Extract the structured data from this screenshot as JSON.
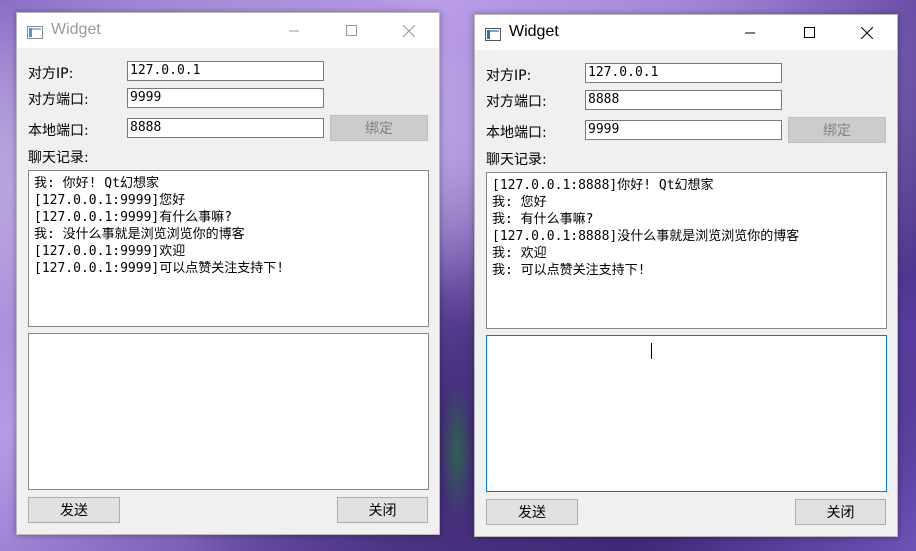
{
  "left_window": {
    "title": "Widget",
    "peer_ip_label": "对方IP:",
    "peer_ip_value": "127.0.0.1",
    "peer_port_label": "对方端口:",
    "peer_port_value": "9999",
    "local_port_label": "本地端口:",
    "local_port_value": "8888",
    "bind_label": "绑定",
    "chat_log_label": "聊天记录:",
    "chat_log": [
      "我: 你好! Qt幻想家",
      "[127.0.0.1:9999]您好",
      "[127.0.0.1:9999]有什么事嘛?",
      "我: 没什么事就是浏览浏览你的博客",
      "[127.0.0.1:9999]欢迎",
      "[127.0.0.1:9999]可以点赞关注支持下!"
    ],
    "message_input_value": "",
    "send_label": "发送",
    "close_label": "关闭"
  },
  "right_window": {
    "title": "Widget",
    "peer_ip_label": "对方IP:",
    "peer_ip_value": "127.0.0.1",
    "peer_port_label": "对方端口:",
    "peer_port_value": "8888",
    "local_port_label": "本地端口:",
    "local_port_value": "9999",
    "bind_label": "绑定",
    "chat_log_label": "聊天记录:",
    "chat_log": [
      "[127.0.0.1:8888]你好! Qt幻想家",
      "我: 您好",
      "我: 有什么事嘛?",
      "[127.0.0.1:8888]没什么事就是浏览浏览你的博客",
      "我: 欢迎",
      "我: 可以点赞关注支持下!"
    ],
    "message_input_value": "",
    "send_label": "发送",
    "close_label": "关闭"
  },
  "colors": {
    "window_bg": "#f0f0f0",
    "titlebar_bg": "#ffffff",
    "focus_border": "#0078d7",
    "disabled_button_bg": "#cccccc"
  },
  "icons": [
    "app-window-icon",
    "minimize-icon",
    "maximize-icon",
    "close-icon"
  ]
}
